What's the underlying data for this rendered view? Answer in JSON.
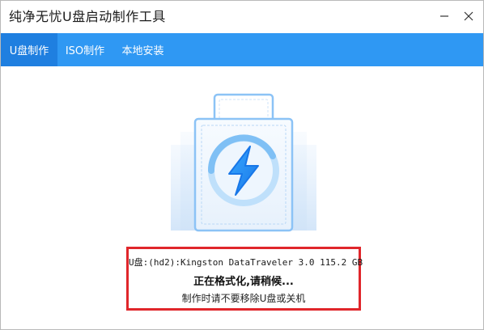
{
  "window": {
    "title": "纯净无忧U盘启动制作工具"
  },
  "tabs": [
    {
      "label": "U盘制作",
      "active": true
    },
    {
      "label": "ISO制作",
      "active": false
    },
    {
      "label": "本地安装",
      "active": false
    }
  ],
  "illustration": {
    "icon": "usb-drive-lightning-icon",
    "accent_color": "#2f98f3"
  },
  "status": {
    "device": "U盘:(hd2):Kingston DataTraveler 3.0 115.2 GB",
    "message": "正在格式化,请稍候...",
    "warning": "制作时请不要移除U盘或关机",
    "highlight_color": "#e0262b"
  }
}
